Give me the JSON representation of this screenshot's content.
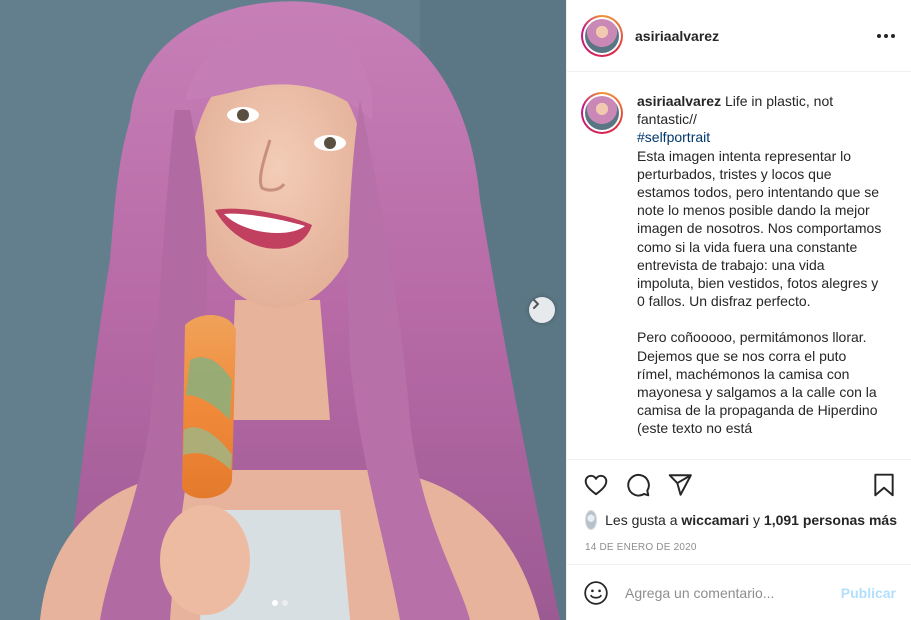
{
  "post": {
    "username": "asiriaalvarez",
    "image_alt": "Woman with long pink hair smiling and holding an orange and green popsicle",
    "carousel": {
      "total": 2,
      "current": 1
    }
  },
  "header": {
    "username": "asiriaalvarez",
    "more_icon": "more-options-icon"
  },
  "caption": {
    "username": "asiriaalvarez",
    "title_line": "Life in plastic, not fantastic//",
    "hashtag": "#selfportrait",
    "paragraph1": "Esta imagen intenta representar lo perturbados, tristes y locos que estamos todos, pero intentando que se note lo menos posible dando la mejor imagen de nosotros. Nos comportamos como si la vida fuera una constante entrevista de trabajo: una vida impoluta, bien vestidos, fotos alegres y 0 fallos. Un disfraz perfecto.",
    "paragraph2": "Pero coñooooo, permitámonos llorar. Dejemos que se nos corra el puto rímel, machémonos la camisa con mayonesa y salgamos a la calle con la camisa de la propaganda de Hiperdino (este texto no está"
  },
  "actions": {
    "like_icon": "heart-icon",
    "comment_icon": "comment-icon",
    "share_icon": "share-icon",
    "save_icon": "bookmark-icon"
  },
  "likes": {
    "prefix": "Les gusta a",
    "user": "wiccamari",
    "connector": "y",
    "others": "1,091 personas más"
  },
  "date": "14 de enero de 2020",
  "comment_box": {
    "placeholder": "Agrega un comentario...",
    "publish_label": "Publicar",
    "emoji_icon": "emoji-icon"
  },
  "colors": {
    "text": "#262626",
    "muted": "#8e8e8e",
    "hashtag": "#00376b",
    "publish_disabled": "#b2dffc",
    "border": "#efefef"
  }
}
